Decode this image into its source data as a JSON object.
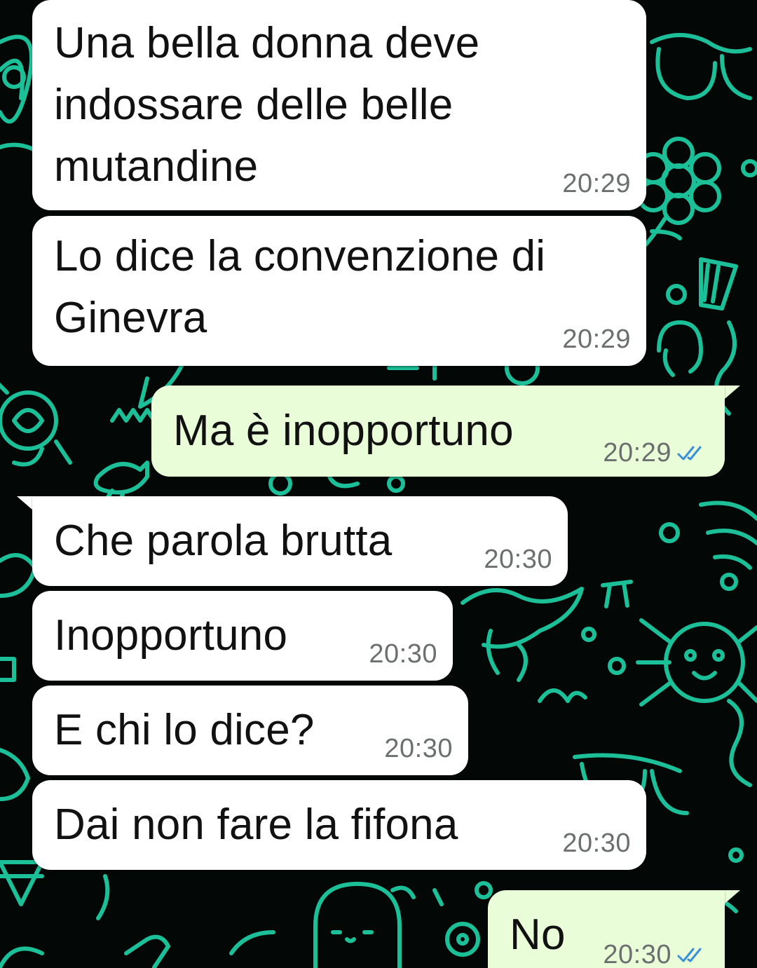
{
  "theme": {
    "incoming_bubble": "#ffffff",
    "outgoing_bubble": "#e8fdd8",
    "read_tick_color": "#3a8fd9",
    "wallpaper_doodle_color": "#1fd4a8",
    "wallpaper_background": "#030807"
  },
  "messages": [
    {
      "direction": "incoming",
      "text": "Una bella donna deve\nindossare delle belle\nmutandine",
      "time": "20:29"
    },
    {
      "direction": "incoming",
      "text": "Lo dice la convenzione di\nGinevra",
      "time": "20:29"
    },
    {
      "direction": "outgoing",
      "text": "Ma è inopportuno",
      "time": "20:29",
      "status": "read",
      "status_icon": "double-check-icon"
    },
    {
      "direction": "incoming",
      "text": "Che parola brutta",
      "time": "20:30"
    },
    {
      "direction": "incoming",
      "text": "Inopportuno",
      "time": "20:30"
    },
    {
      "direction": "incoming",
      "text": "E chi lo dice?",
      "time": "20:30"
    },
    {
      "direction": "incoming",
      "text": "Dai non fare la fifona",
      "time": "20:30"
    },
    {
      "direction": "outgoing",
      "text": "No",
      "time": "20:30",
      "status": "read",
      "status_icon": "double-check-icon"
    }
  ]
}
